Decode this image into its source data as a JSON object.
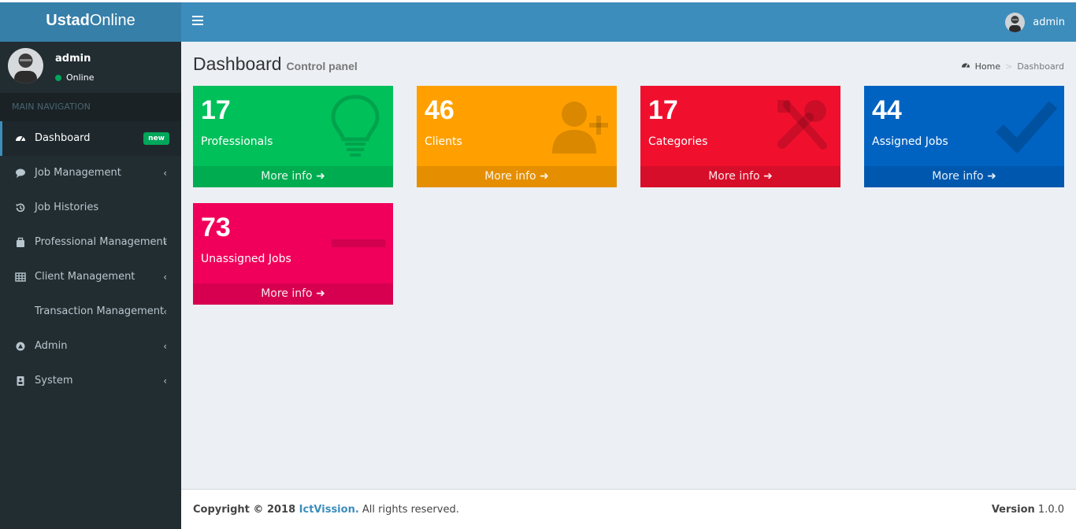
{
  "app": {
    "logo_bold": "Ustad",
    "logo_light": "Online"
  },
  "header": {
    "user_name": "admin"
  },
  "sidebar": {
    "user": {
      "name": "admin",
      "status": "Online"
    },
    "nav_header": "MAIN NAVIGATION",
    "items": [
      {
        "label": "Dashboard",
        "icon": "dashboard-icon",
        "badge": "new"
      },
      {
        "label": "Job Management",
        "icon": "comment-icon"
      },
      {
        "label": "Job Histories",
        "icon": "history-icon"
      },
      {
        "label": "Professional Management",
        "icon": "briefcase-icon"
      },
      {
        "label": "Client Management",
        "icon": "table-icon"
      },
      {
        "label": "Transaction Management",
        "icon": ""
      },
      {
        "label": "Admin",
        "icon": "admin-icon"
      },
      {
        "label": "System",
        "icon": "system-icon"
      }
    ]
  },
  "page": {
    "title": "Dashboard",
    "subtitle": "Control panel",
    "breadcrumb": {
      "home": "Home",
      "current": "Dashboard"
    }
  },
  "boxes": [
    {
      "value": "17",
      "label": "Professionals",
      "more": "More info",
      "color": "#00c05a",
      "icon": "lightbulb-icon"
    },
    {
      "value": "46",
      "label": "Clients",
      "more": "More info",
      "color": "#ffa000",
      "icon": "user-plus-icon"
    },
    {
      "value": "17",
      "label": "Categories",
      "more": "More info",
      "color": "#f0102e",
      "icon": "tools-icon"
    },
    {
      "value": "44",
      "label": "Assigned Jobs",
      "more": "More info",
      "color": "#0063c2",
      "icon": "check-icon"
    },
    {
      "value": "73",
      "label": "Unassigned Jobs",
      "more": "More info",
      "color": "#f0005a",
      "icon": "minus-icon"
    }
  ],
  "footer": {
    "copyright": "Copyright © 2018 ",
    "company": "IctVission.",
    "rights": " All rights reserved.",
    "version_label": "Version",
    "version": "1.0.0"
  }
}
